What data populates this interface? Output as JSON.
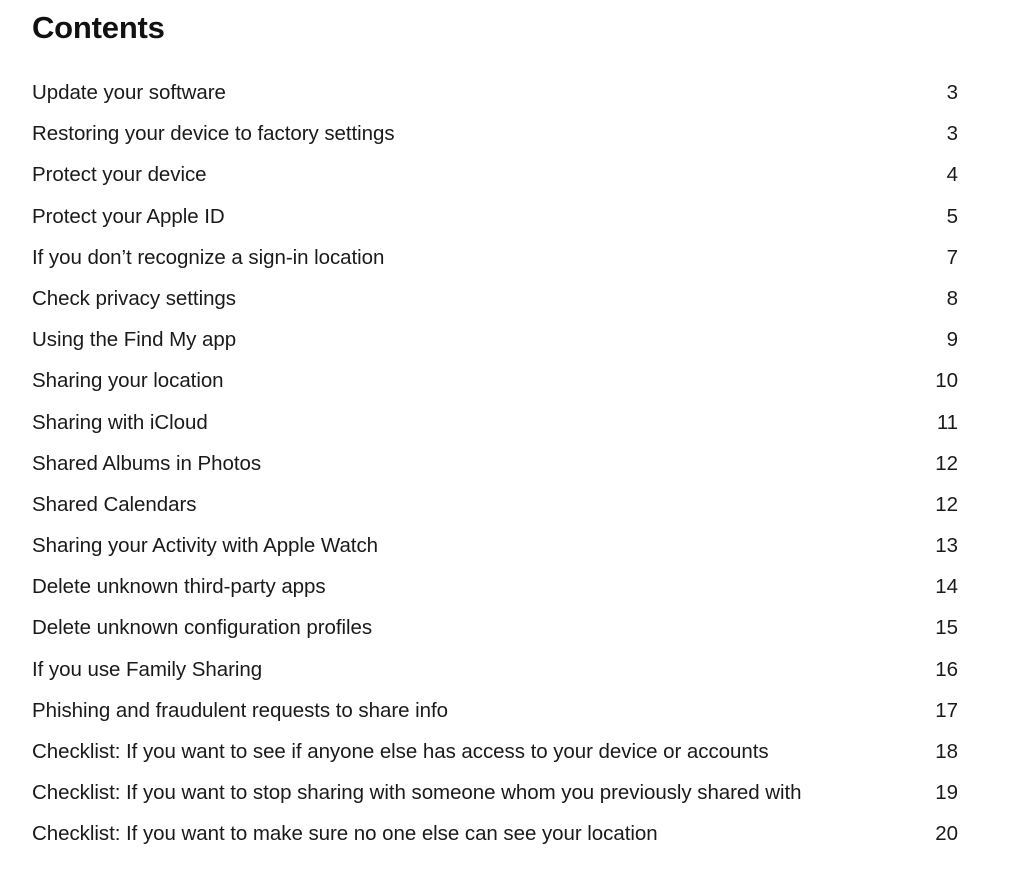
{
  "document": {
    "heading": "Contents",
    "background_color": "#ffffff",
    "text_color": "#1a1a1a"
  },
  "toc": {
    "entries": [
      {
        "label": "Update your software",
        "page": "3"
      },
      {
        "label": "Restoring your device to factory settings",
        "page": "3"
      },
      {
        "label": "Protect your device",
        "page": "4"
      },
      {
        "label": "Protect your Apple ID",
        "page": "5"
      },
      {
        "label": "If you don’t recognize a sign-in location",
        "page": "7"
      },
      {
        "label": "Check privacy settings",
        "page": "8"
      },
      {
        "label": "Using the Find My app",
        "page": "9"
      },
      {
        "label": "Sharing your location",
        "page": "10"
      },
      {
        "label": "Sharing with iCloud",
        "page": "11"
      },
      {
        "label": "Shared Albums in Photos",
        "page": "12"
      },
      {
        "label": "Shared Calendars",
        "page": "12"
      },
      {
        "label": "Sharing your Activity with Apple Watch",
        "page": "13"
      },
      {
        "label": "Delete unknown third-party apps",
        "page": "14"
      },
      {
        "label": "Delete unknown configuration profiles",
        "page": "15"
      },
      {
        "label": "If you use Family Sharing",
        "page": "16"
      },
      {
        "label": "Phishing and fraudulent requests to share info",
        "page": "17"
      },
      {
        "label": "Checklist: If you want to see if anyone else has access to your device or accounts",
        "page": "18"
      },
      {
        "label": "Checklist: If you want to stop sharing with someone whom you previously shared with",
        "page": "19"
      },
      {
        "label": "Checklist: If you want to make sure no one else can see your location",
        "page": "20"
      }
    ]
  }
}
